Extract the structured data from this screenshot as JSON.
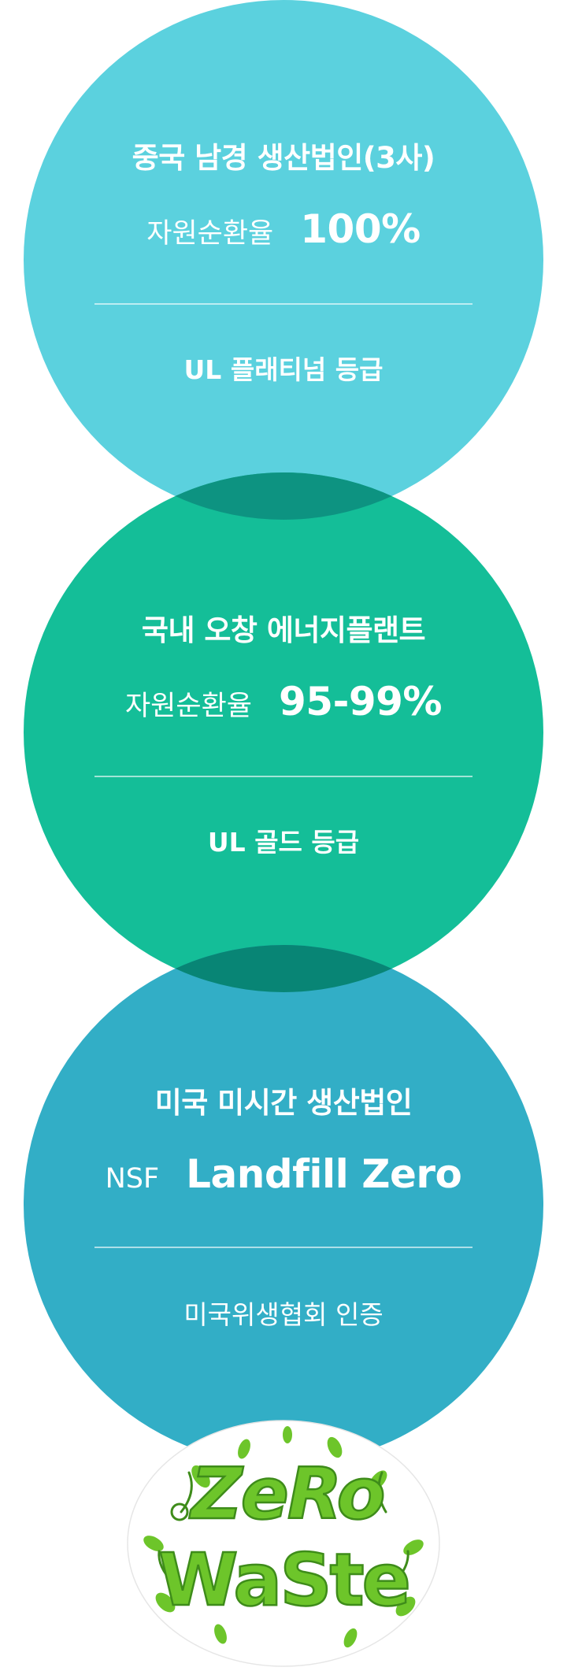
{
  "colors": {
    "circle_1": "#5BD1DE",
    "circle_2": "#14BE98",
    "circle_3": "#32AEC6",
    "overlap_1_2": "#0D9381",
    "overlap_2_3": "#088575",
    "logo_green": "#6DC52A",
    "logo_dark": "#3E8C1A"
  },
  "sites": [
    {
      "title": "중국 남경 생산법인(3사)",
      "metric_label": "자원순환율",
      "metric_value": "100%",
      "certification": "UL 플래티넘 등급"
    },
    {
      "title": "국내 오창 에너지플랜트",
      "metric_label": "자원순환율",
      "metric_value": "95-99%",
      "certification": "UL 골드 등급"
    },
    {
      "title": "미국 미시간 생산법인",
      "metric_label": "NSF",
      "metric_value": "Landfill Zero",
      "certification": "미국위생협회 인증"
    }
  ],
  "logo": {
    "line1": "ZeRo",
    "line2": "WaSte"
  }
}
